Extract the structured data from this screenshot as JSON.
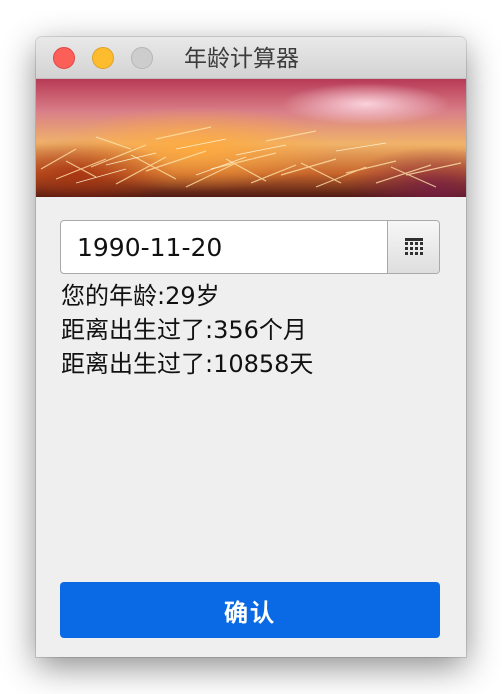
{
  "window": {
    "title": "年龄计算器"
  },
  "date_picker": {
    "value": "1990-11-20",
    "icon": "calendar-icon"
  },
  "results": {
    "age": "您的年龄:29岁",
    "months": "距离出生过了:356个月",
    "days": "距离出生过了:10858天"
  },
  "confirm_button": {
    "label": "确认"
  },
  "colors": {
    "accent": "#0a6ae6",
    "close": "#fc5f57",
    "minimize": "#fdbc2e",
    "zoom": "#cdcdcd"
  }
}
